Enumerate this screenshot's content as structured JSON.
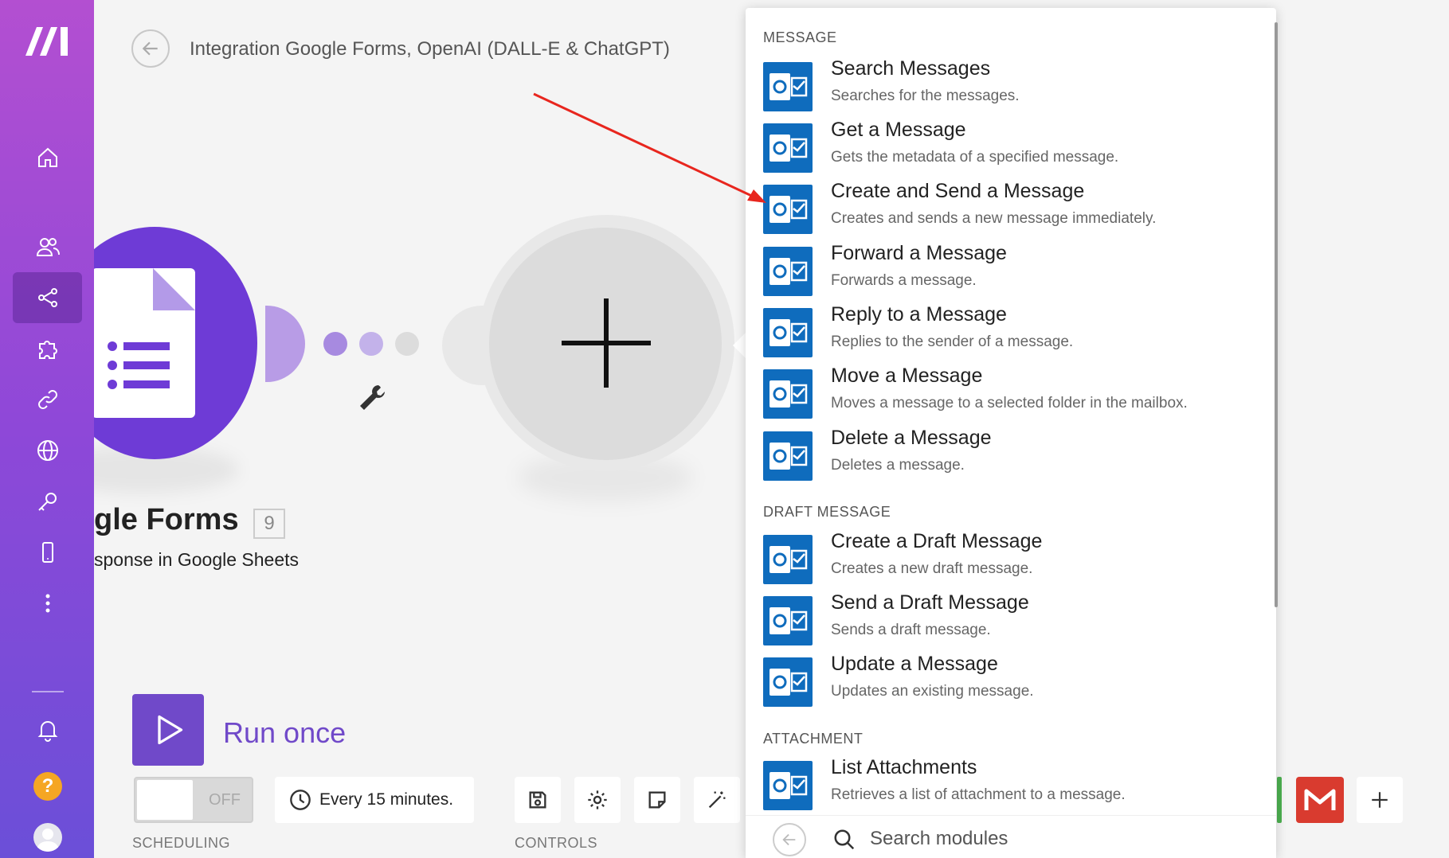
{
  "header": {
    "title": "Integration Google Forms, OpenAI (DALL-E & ChatGPT)"
  },
  "sidebar": {
    "items": [
      {
        "icon": "home-icon"
      },
      {
        "icon": "team-icon"
      },
      {
        "icon": "scenarios-icon",
        "active": true
      },
      {
        "icon": "apps-icon"
      },
      {
        "icon": "connections-icon"
      },
      {
        "icon": "webhooks-icon"
      },
      {
        "icon": "keys-icon"
      },
      {
        "icon": "devices-icon"
      },
      {
        "icon": "more-icon"
      }
    ],
    "help_label": "?"
  },
  "canvas": {
    "module_name": "gle Forms",
    "module_badge": "9",
    "module_subtitle": "sponse in Google Sheets"
  },
  "run": {
    "label": "Run once"
  },
  "scheduling": {
    "toggle_label": "OFF",
    "schedule_label": "Every 15 minutes.",
    "section_label": "SCHEDULING"
  },
  "controls": {
    "section_label": "CONTROLS"
  },
  "panel": {
    "sections": [
      {
        "title": "MESSAGE",
        "items": [
          {
            "title": "Search Messages",
            "desc": "Searches for the messages."
          },
          {
            "title": "Get a Message",
            "desc": "Gets the metadata of a specified message."
          },
          {
            "title": "Create and Send a Message",
            "desc": "Creates and sends a new message immediately."
          },
          {
            "title": "Forward a Message",
            "desc": "Forwards a message."
          },
          {
            "title": "Reply to a Message",
            "desc": "Replies to the sender of a message."
          },
          {
            "title": "Move a Message",
            "desc": "Moves a message to a selected folder in the mailbox."
          },
          {
            "title": "Delete a Message",
            "desc": "Deletes a message."
          }
        ]
      },
      {
        "title": "DRAFT MESSAGE",
        "items": [
          {
            "title": "Create a Draft Message",
            "desc": "Creates a new draft message."
          },
          {
            "title": "Send a Draft Message",
            "desc": "Sends a draft message."
          },
          {
            "title": "Update a Message",
            "desc": "Updates an existing message."
          }
        ]
      },
      {
        "title": "ATTACHMENT",
        "items": [
          {
            "title": "List Attachments",
            "desc": "Retrieves a list of attachment to a message."
          }
        ]
      }
    ],
    "search": {
      "placeholder": "Search modules"
    }
  },
  "colors": {
    "sidebar_top": "#b34fd1",
    "sidebar_bottom": "#6b4fd8",
    "accent": "#7049c9",
    "outlook_blue": "#0f6cbd",
    "gmail_red": "#d93b2f",
    "annotation_arrow": "#e8261e"
  }
}
